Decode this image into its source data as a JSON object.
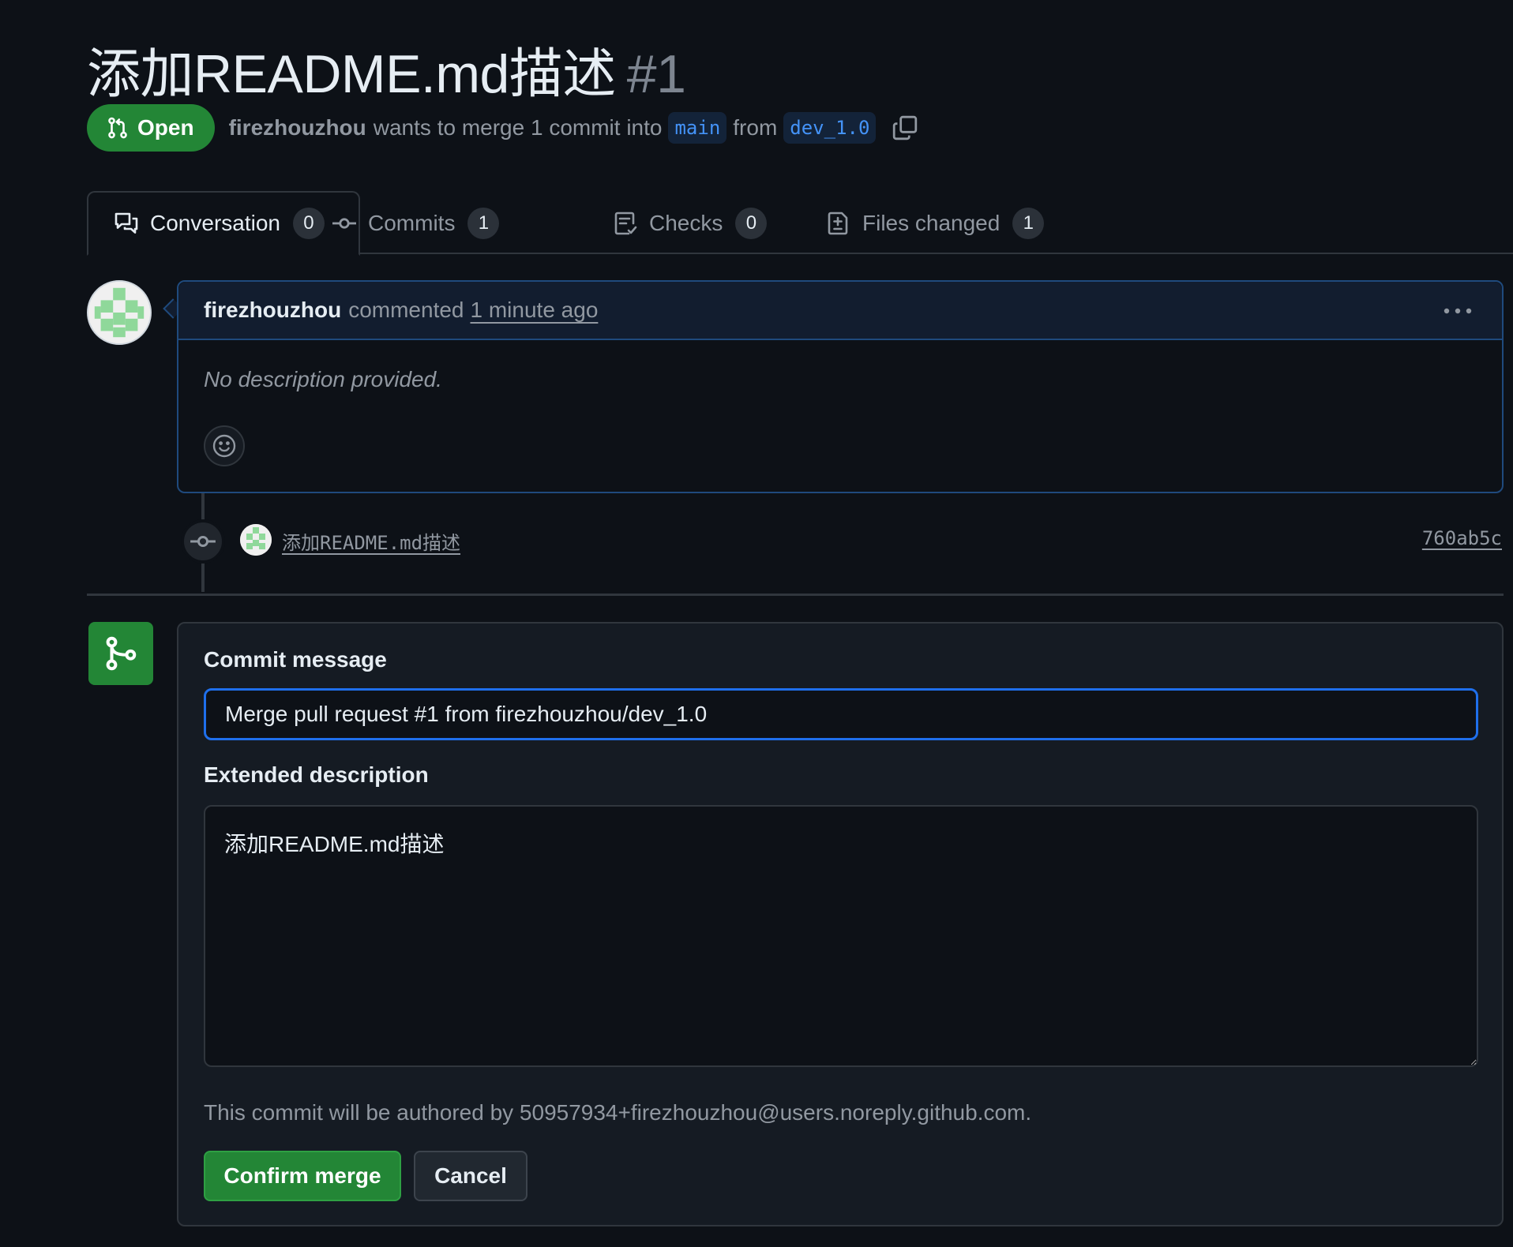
{
  "pr": {
    "title": "添加README.md描述",
    "number": "#1",
    "state": "Open",
    "author": "firezhouzhou",
    "merge_text": "wants to merge 1 commit into",
    "base_branch": "main",
    "from_text": "from",
    "head_branch": "dev_1.0"
  },
  "tabs": [
    {
      "label": "Conversation",
      "count": "0"
    },
    {
      "label": "Commits",
      "count": "1"
    },
    {
      "label": "Checks",
      "count": "0"
    },
    {
      "label": "Files changed",
      "count": "1"
    }
  ],
  "comment": {
    "author": "firezhouzhou",
    "action": "commented",
    "time": "1 minute ago",
    "body": "No description provided."
  },
  "commit": {
    "message": "添加README.md描述",
    "sha": "760ab5c"
  },
  "merge_form": {
    "commit_message_label": "Commit message",
    "commit_message_value": "Merge pull request #1 from firezhouzhou/dev_1.0",
    "extended_label": "Extended description",
    "extended_value": "添加README.md描述",
    "author_note": "This commit will be authored by 50957934+firezhouzhou@users.noreply.github.com.",
    "confirm_label": "Confirm merge",
    "cancel_label": "Cancel"
  },
  "colors": {
    "background": "#0d1117",
    "open_green": "#238636",
    "accent_blue": "#1f6feb",
    "link_blue": "#4493f8"
  },
  "icons": {
    "state": "git-pull-request-icon",
    "copy": "copy-icon",
    "conversation": "comment-discussion-icon",
    "commits": "git-commit-icon",
    "checks": "checklist-icon",
    "files": "file-diff-icon",
    "kebab": "kebab-horizontal-icon",
    "emoji": "smiley-icon",
    "merge": "git-merge-icon"
  }
}
